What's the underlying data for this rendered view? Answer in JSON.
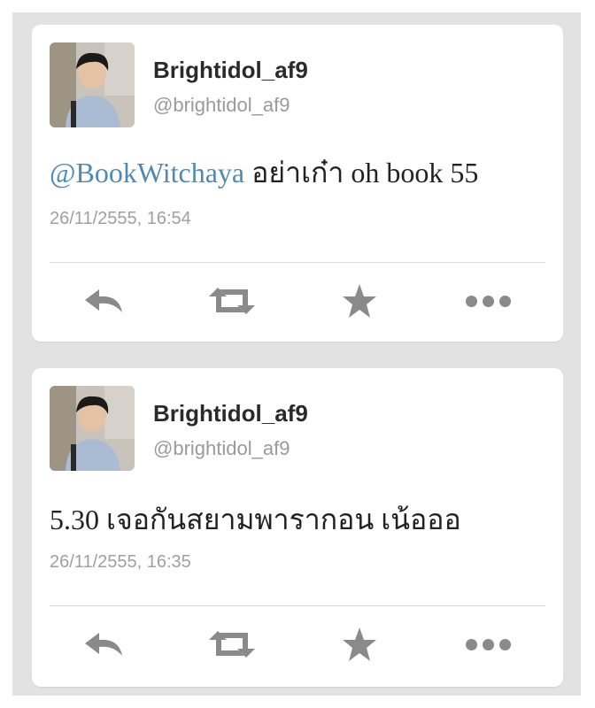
{
  "colors": {
    "mention": "#4f8ab4",
    "icon": "#8a8a8a",
    "background": "#e2e2e2"
  },
  "tweets": [
    {
      "display_name": "Brightidol_af9",
      "handle": "@brightidol_af9",
      "mention": "@BookWitchaya",
      "text": " อย่าเก๋า oh book 55",
      "timestamp": "26/11/2555, 16:54",
      "actions": [
        "reply-icon",
        "retweet-icon",
        "favorite-icon",
        "more-icon"
      ]
    },
    {
      "display_name": "Brightidol_af9",
      "handle": "@brightidol_af9",
      "mention": "",
      "text": "5.30 เจอกันสยามพารากอน เน้อออ",
      "timestamp": "26/11/2555, 16:35",
      "actions": [
        "reply-icon",
        "retweet-icon",
        "favorite-icon",
        "more-icon"
      ]
    }
  ]
}
